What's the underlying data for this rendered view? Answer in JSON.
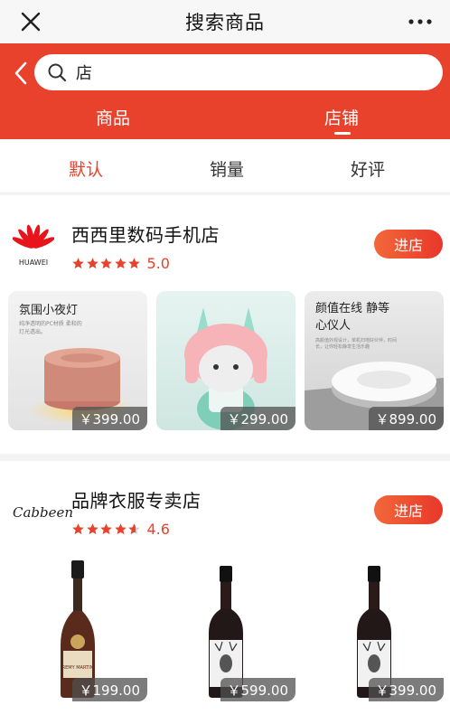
{
  "header": {
    "title": "搜索商品",
    "close_icon": "close-icon",
    "more_icon": "more-icon"
  },
  "search": {
    "value": "店",
    "icon": "search-icon",
    "back_icon": "chevron-left-icon"
  },
  "tabs": [
    {
      "label": "商品",
      "active": false
    },
    {
      "label": "店铺",
      "active": true
    }
  ],
  "sort": [
    {
      "label": "默认",
      "active": true
    },
    {
      "label": "销量"
    },
    {
      "label": "好评"
    }
  ],
  "colors": {
    "accent": "#e8412c",
    "star": "#e8412c"
  },
  "shops": [
    {
      "name": "西西里数码手机店",
      "logo_text": "HUAWEI",
      "stars": 5,
      "rating": "5.0",
      "enter_label": "进店",
      "products": [
        {
          "caption": "氛围小夜灯",
          "subcaption": "纯净透明的PC材质 柔和的灯光透出。",
          "price": "￥399.00"
        },
        {
          "price": "￥299.00"
        },
        {
          "caption": "颜值在线 静等心仪人",
          "subcaption": "高颜值外观设计，单机扫地好伙伴，时间长，让你轻松静享生活乐趣",
          "price": "￥899.00"
        }
      ]
    },
    {
      "name": "品牌衣服专卖店",
      "logo_text": "Cabbeen",
      "stars": 4.6,
      "rating": "4.6",
      "enter_label": "进店",
      "products": [
        {
          "label_text": "REMY MARTIN",
          "price": "￥199.00"
        },
        {
          "price": "￥599.00"
        },
        {
          "price": "￥399.00"
        }
      ]
    }
  ]
}
